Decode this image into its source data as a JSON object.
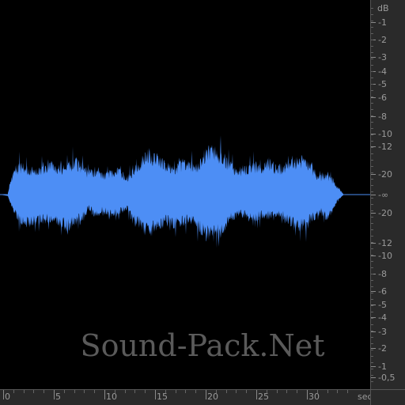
{
  "waveform": {
    "color": "#4d8ef5",
    "background": "#000000",
    "duration_sec": 36.5
  },
  "db_ruler": {
    "unit": "dB",
    "upper": [
      "-1",
      "-2",
      "-3",
      "-4",
      "-5",
      "-6",
      "-8",
      "-10",
      "-12",
      "-20"
    ],
    "center": "-∞",
    "lower": [
      "-20",
      "-12",
      "-10",
      "-8",
      "-6",
      "-5",
      "-4",
      "-3",
      "-2",
      "-1",
      "-0,5"
    ]
  },
  "time_ruler": {
    "unit": "sec",
    "labels": [
      "0",
      "5",
      "10",
      "15",
      "20",
      "25",
      "30"
    ]
  },
  "watermark": "Sound-Pack.Net"
}
